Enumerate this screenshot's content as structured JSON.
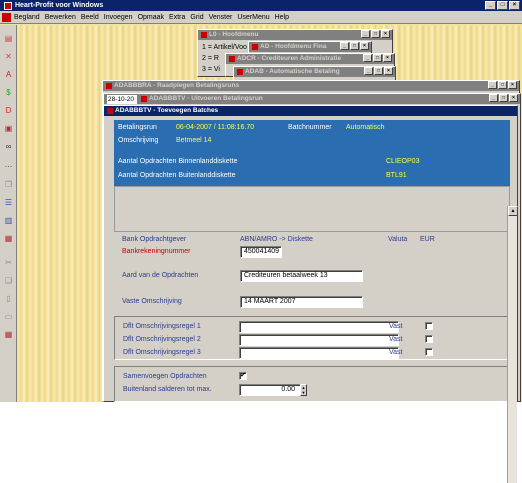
{
  "app": {
    "title": "Heart-Profit voor Windows",
    "menu": [
      "Begland",
      "Bewerken",
      "Beeld",
      "Invoegen",
      "Opmaak",
      "Extra",
      "Grid",
      "Venster",
      "UserMenu",
      "Help"
    ]
  },
  "toolbar_icons": [
    "form-icon",
    "cross-icon",
    "a-letter-icon",
    "dollar-icon",
    "d-letter-icon",
    "printer-icon",
    "binoculars-icon",
    "dots-icon",
    "copy-icon",
    "list-icon",
    "table-icon",
    "grid-icon",
    "scissors-icon",
    "paste-icon",
    "doc-icon",
    "page-icon",
    "grid2-icon"
  ],
  "windows": {
    "hoofdmenu": {
      "title": "L0 - Hoofdmenu",
      "lines": [
        "1 = Artikel/Voo",
        "2 = R",
        "3 = Vi"
      ]
    },
    "ad": {
      "title": "AD - Hoofdmenu Fina"
    },
    "adcr": {
      "title": "ADCR - Crediteuren Administratie"
    },
    "adab": {
      "title": "ADAB - Automatische Betaling"
    },
    "adabbbra": {
      "title": "ADABBBRA - Raadplegen Betalingsruns",
      "date": "28-10-20"
    },
    "adabbbtv": {
      "title": "ADABBBTV - Uitvoeren Betalingsrun"
    },
    "main": {
      "title": "ADABBBTV - Toevoegen Batches"
    }
  },
  "header": {
    "betalingsrun_label": "Betalingsrun",
    "betalingsrun_value": "06-04-2007 / 11:08:16.70",
    "batchnummer_label": "Batchnummer",
    "batchnummer_value": "Automatisch",
    "omschrijving_label": "Omschrijving",
    "omschrijving_value": "Betmeel 14",
    "binnenland_label": "Aantal Opdrachten Binnenlanddiskette",
    "binnenland_value": "CLIEOP03",
    "buitenland_label": "Aantal Opdrachten Buitenlanddiskette",
    "buitenland_value": "BTL91"
  },
  "form": {
    "bank_label": "Bank Opdrachtgever",
    "bank_value": "ABN/AMRO -> Diskette",
    "valuta_label": "Valuta",
    "valuta_value": "EUR",
    "rekening_label": "Bankrekeningnummer",
    "rekening_value": "450041409",
    "aard_label": "Aard van de Opdrachten",
    "aard_value": "Crediteuren betaalweek 13",
    "vaste_label": "Vaste Omschrijving",
    "vaste_value": "14 MAART 2007",
    "dflt1_label": "Dflt Omschrijvingsregel 1",
    "dflt2_label": "Dflt Omschrijvingsregel 2",
    "dflt3_label": "Dflt Omschrijvingsregel 3",
    "vast_label": "Vast",
    "samenvoegen_label": "Samenvoegen Opdrachten",
    "samenvoegen_checked": "✔",
    "buitenland_saldo_label": "Buitenland salderen tot max.",
    "buitenland_saldo_value": "0.00"
  }
}
